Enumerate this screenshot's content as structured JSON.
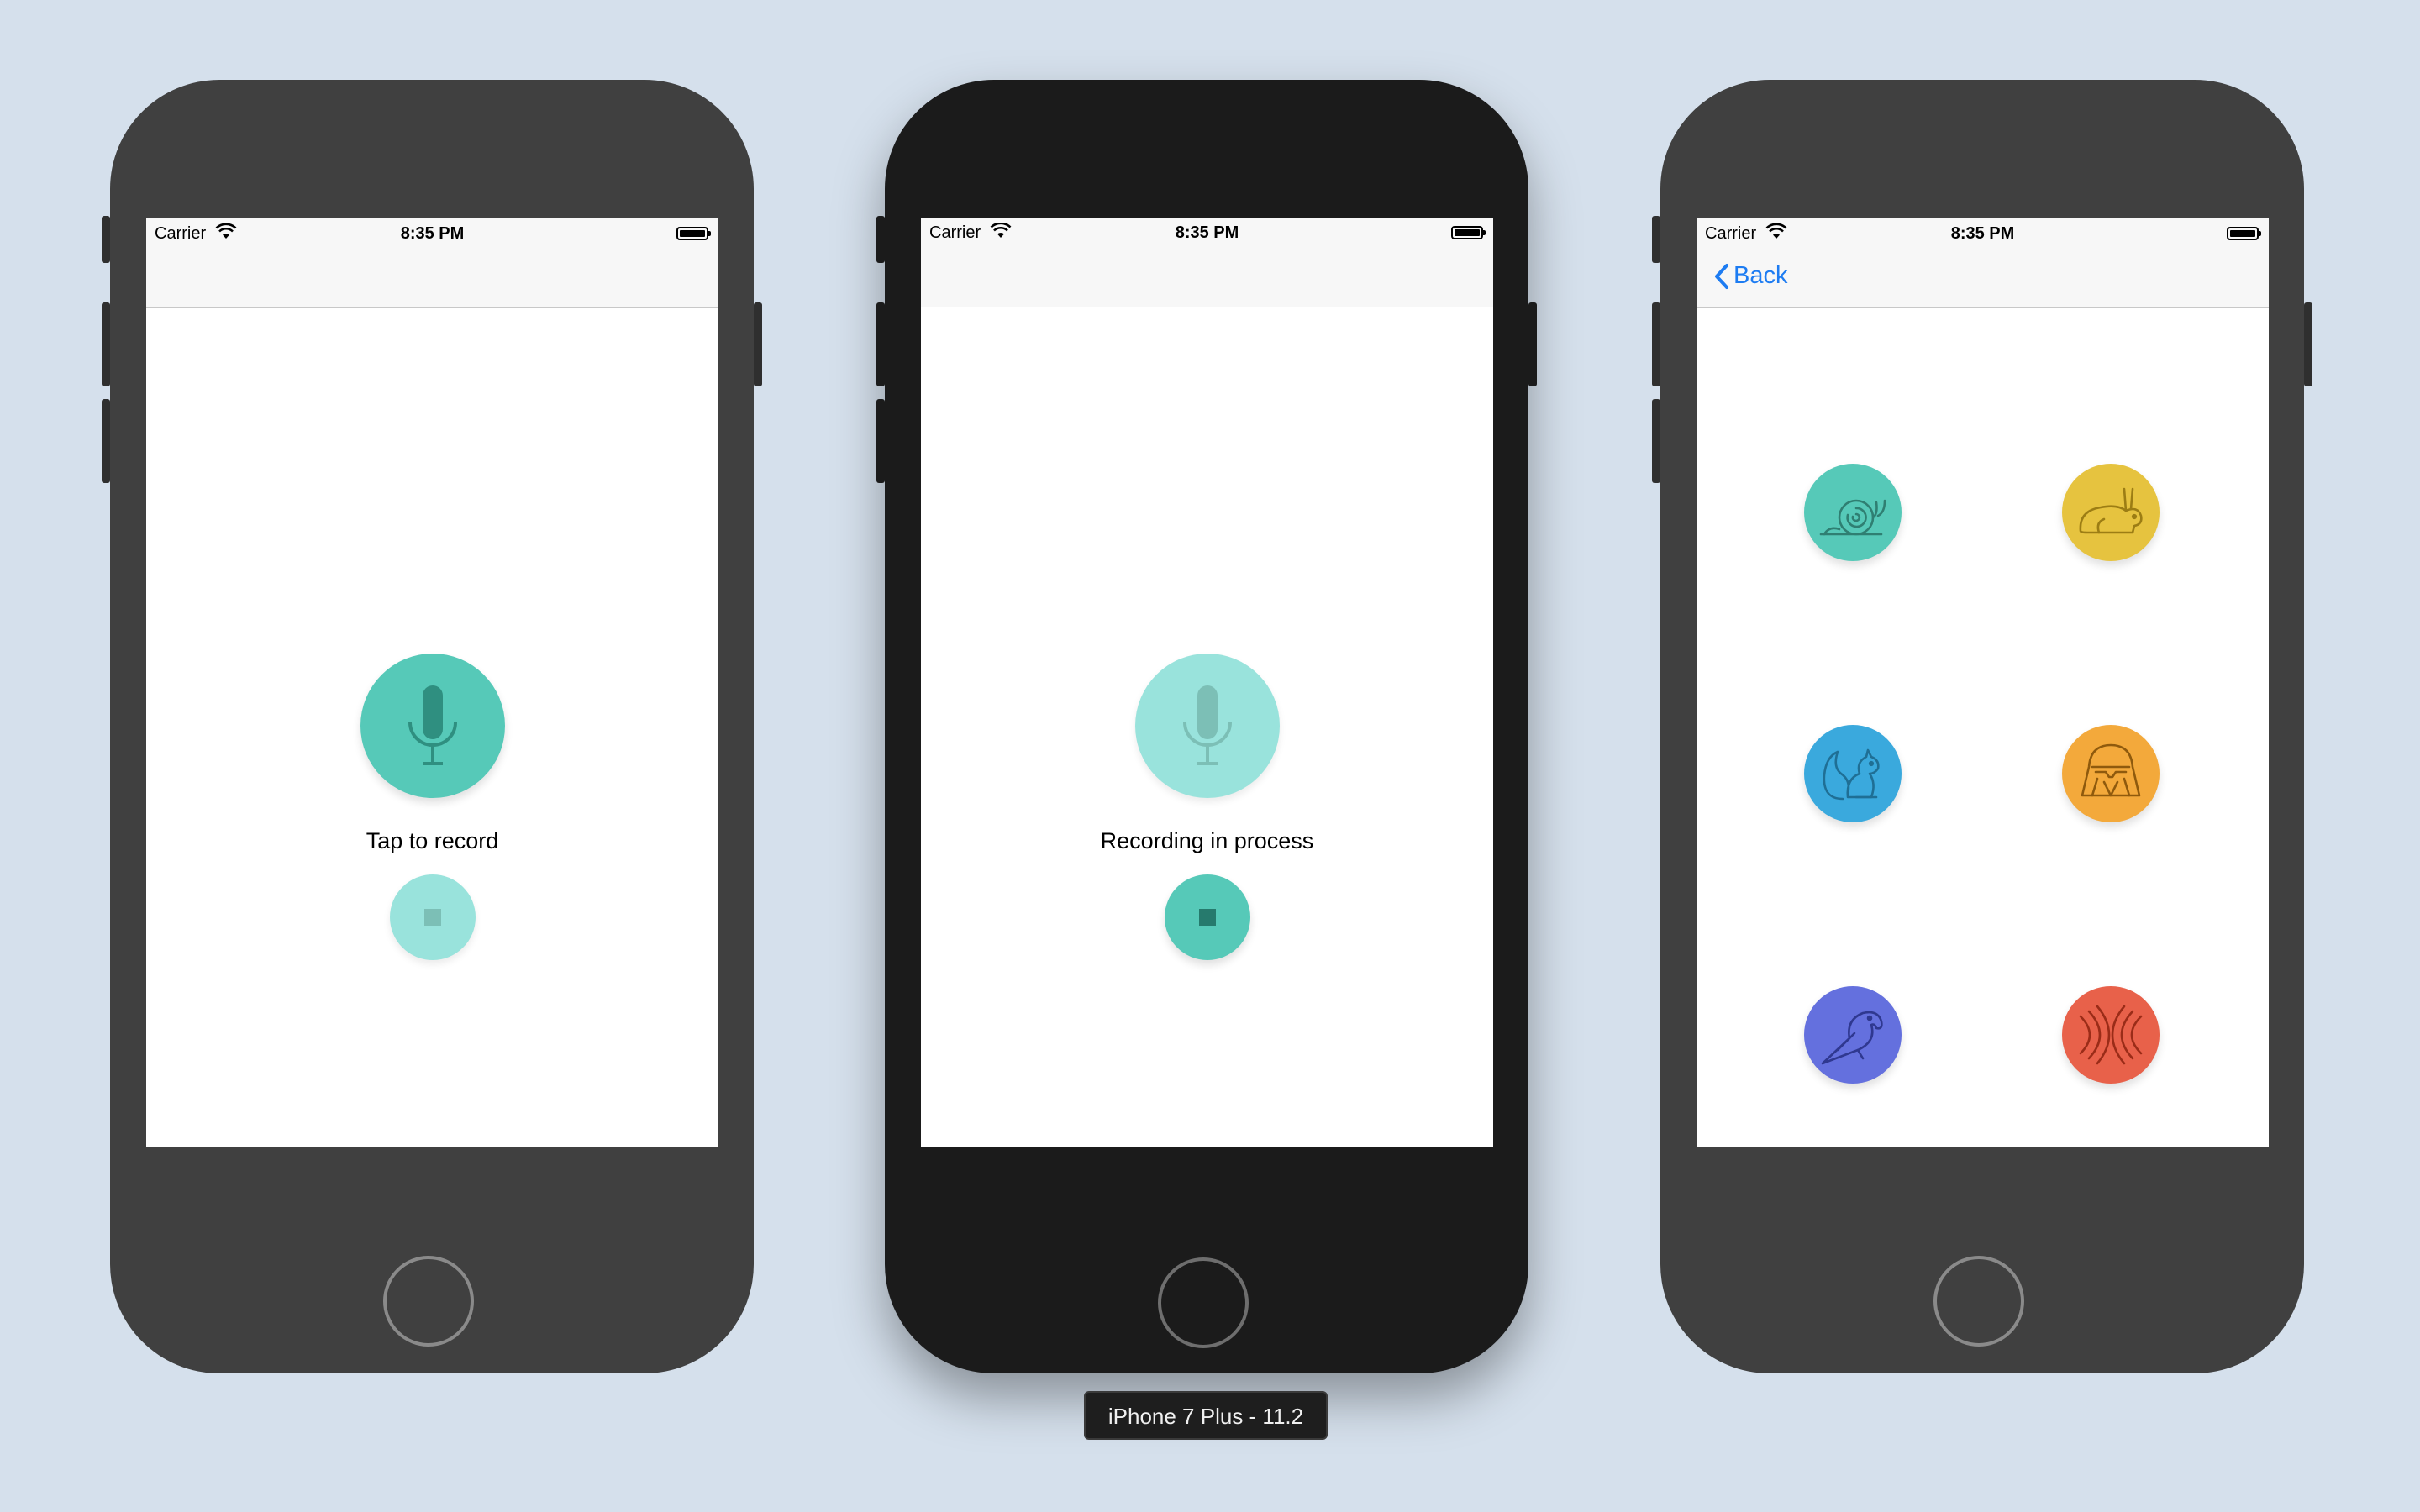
{
  "status_bar": {
    "carrier": "Carrier",
    "time": "8:35 PM"
  },
  "screen_record_idle": {
    "caption": "Tap to record"
  },
  "screen_recording": {
    "caption": "Recording in process"
  },
  "screen_sounds": {
    "back_label": "Back",
    "buttons": [
      "snail-icon",
      "rabbit-icon",
      "squirrel-icon",
      "vader-icon",
      "parrot-icon",
      "echo-icon"
    ]
  },
  "device_label": "iPhone 7 Plus - 11.2",
  "colors": {
    "teal": "#56c9b8",
    "teal_light": "#99e3dc",
    "yellow": "#e6c33f",
    "blue": "#3aa9dd",
    "orange": "#f3a93b",
    "indigo": "#6470de",
    "red": "#e8614a",
    "ios_blue": "#1d7cf2",
    "background": "#d5e0ec"
  }
}
